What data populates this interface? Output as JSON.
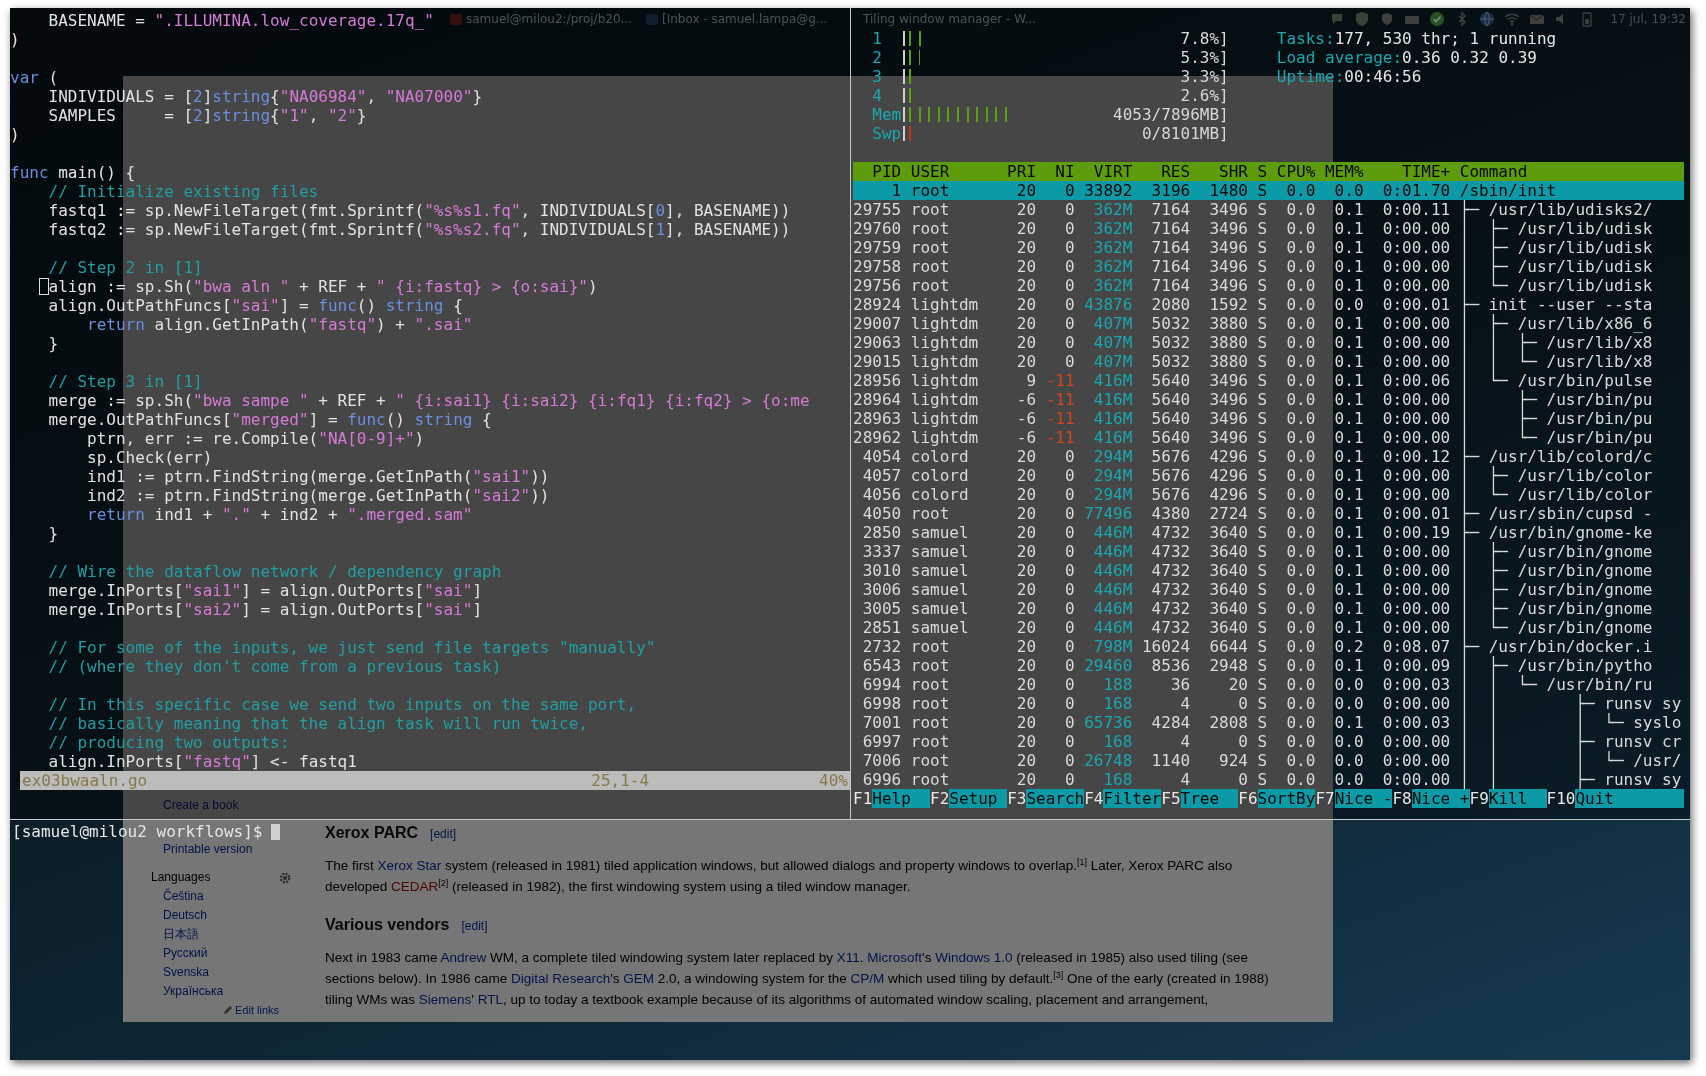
{
  "taskbar": {
    "windows": [
      {
        "title": "samuel@milou2:/proj/b20..."
      },
      {
        "title": "[Inbox - samuel.lampa@g..."
      }
    ],
    "active_title": "Tiling window manager - W...",
    "clock": "17 jul, 19:32"
  },
  "editor": {
    "lines": [
      {
        "kind": "code",
        "segs": [
          {
            "kind": "plain",
            "text": "    BASENAME = "
          },
          {
            "kind": "string",
            "text": "\".ILLUMINA.low_coverage.17q_\""
          }
        ]
      },
      {
        "kind": "code",
        "segs": [
          {
            "kind": "plain",
            "text": ")"
          }
        ]
      },
      {
        "kind": "blank"
      },
      {
        "kind": "code",
        "segs": [
          {
            "kind": "keyword",
            "text": "var"
          },
          {
            "kind": "plain",
            "text": " ("
          }
        ]
      },
      {
        "kind": "code",
        "segs": [
          {
            "kind": "plain",
            "text": "    INDIVIDUALS = ["
          },
          {
            "kind": "number",
            "text": "2"
          },
          {
            "kind": "plain",
            "text": "]"
          },
          {
            "kind": "keyword",
            "text": "string"
          },
          {
            "kind": "plain",
            "text": "{"
          },
          {
            "kind": "string",
            "text": "\"NA06984\""
          },
          {
            "kind": "plain",
            "text": ", "
          },
          {
            "kind": "string",
            "text": "\"NA07000\""
          },
          {
            "kind": "plain",
            "text": "}"
          }
        ]
      },
      {
        "kind": "code",
        "segs": [
          {
            "kind": "plain",
            "text": "    SAMPLES     = ["
          },
          {
            "kind": "number",
            "text": "2"
          },
          {
            "kind": "plain",
            "text": "]"
          },
          {
            "kind": "keyword",
            "text": "string"
          },
          {
            "kind": "plain",
            "text": "{"
          },
          {
            "kind": "string",
            "text": "\"1\""
          },
          {
            "kind": "plain",
            "text": ", "
          },
          {
            "kind": "string",
            "text": "\"2\""
          },
          {
            "kind": "plain",
            "text": "}"
          }
        ]
      },
      {
        "kind": "code",
        "segs": [
          {
            "kind": "plain",
            "text": ")"
          }
        ]
      },
      {
        "kind": "blank"
      },
      {
        "kind": "code",
        "segs": [
          {
            "kind": "keyword",
            "text": "func"
          },
          {
            "kind": "plain",
            "text": " main() {"
          }
        ]
      },
      {
        "kind": "code",
        "segs": [
          {
            "kind": "comment",
            "text": "    // Initialize existing files"
          }
        ]
      },
      {
        "kind": "code",
        "segs": [
          {
            "kind": "plain",
            "text": "    fastq1 := sp.NewFileTarget(fmt.Sprintf("
          },
          {
            "kind": "string",
            "text": "\"%s%s1.fq\""
          },
          {
            "kind": "plain",
            "text": ", INDIVIDUALS["
          },
          {
            "kind": "number",
            "text": "0"
          },
          {
            "kind": "plain",
            "text": "], BASENAME))"
          }
        ]
      },
      {
        "kind": "code",
        "segs": [
          {
            "kind": "plain",
            "text": "    fastq2 := sp.NewFileTarget(fmt.Sprintf("
          },
          {
            "kind": "string",
            "text": "\"%s%s2.fq\""
          },
          {
            "kind": "plain",
            "text": ", INDIVIDUALS["
          },
          {
            "kind": "number",
            "text": "1"
          },
          {
            "kind": "plain",
            "text": "], BASENAME))"
          }
        ]
      },
      {
        "kind": "blank"
      },
      {
        "kind": "code",
        "segs": [
          {
            "kind": "comment",
            "text": "    // Step 2 in [1]"
          }
        ]
      },
      {
        "kind": "code",
        "cursor": true,
        "segs": [
          {
            "kind": "plain",
            "text": "    align := sp.Sh("
          },
          {
            "kind": "string",
            "text": "\"bwa aln \""
          },
          {
            "kind": "plain",
            "text": " + REF + "
          },
          {
            "kind": "string",
            "text": "\" {i:fastq} > {o:sai}\""
          },
          {
            "kind": "plain",
            "text": ")"
          }
        ]
      },
      {
        "kind": "code",
        "segs": [
          {
            "kind": "plain",
            "text": "    align.OutPathFuncs["
          },
          {
            "kind": "string",
            "text": "\"sai\""
          },
          {
            "kind": "plain",
            "text": "] = "
          },
          {
            "kind": "keyword",
            "text": "func"
          },
          {
            "kind": "plain",
            "text": "() "
          },
          {
            "kind": "keyword",
            "text": "string"
          },
          {
            "kind": "plain",
            "text": " {"
          }
        ]
      },
      {
        "kind": "code",
        "segs": [
          {
            "kind": "keyword",
            "text": "        return"
          },
          {
            "kind": "plain",
            "text": " align.GetInPath("
          },
          {
            "kind": "string",
            "text": "\"fastq\""
          },
          {
            "kind": "plain",
            "text": ") + "
          },
          {
            "kind": "string",
            "text": "\".sai\""
          }
        ]
      },
      {
        "kind": "code",
        "segs": [
          {
            "kind": "plain",
            "text": "    }"
          }
        ]
      },
      {
        "kind": "blank"
      },
      {
        "kind": "code",
        "segs": [
          {
            "kind": "comment",
            "text": "    // Step 3 in [1]"
          }
        ]
      },
      {
        "kind": "code",
        "segs": [
          {
            "kind": "plain",
            "text": "    merge := sp.Sh("
          },
          {
            "kind": "string",
            "text": "\"bwa sampe \""
          },
          {
            "kind": "plain",
            "text": " + REF + "
          },
          {
            "kind": "string",
            "text": "\" {i:sai1} {i:sai2} {i:fq1} {i:fq2} > {o:me"
          }
        ]
      },
      {
        "kind": "code",
        "segs": [
          {
            "kind": "plain",
            "text": "    merge.OutPathFuncs["
          },
          {
            "kind": "string",
            "text": "\"merged\""
          },
          {
            "kind": "plain",
            "text": "] = "
          },
          {
            "kind": "keyword",
            "text": "func"
          },
          {
            "kind": "plain",
            "text": "() "
          },
          {
            "kind": "keyword",
            "text": "string"
          },
          {
            "kind": "plain",
            "text": " {"
          }
        ]
      },
      {
        "kind": "code",
        "segs": [
          {
            "kind": "plain",
            "text": "        ptrn, err := re.Compile("
          },
          {
            "kind": "string",
            "text": "\"NA[0-9]+\""
          },
          {
            "kind": "plain",
            "text": ")"
          }
        ]
      },
      {
        "kind": "code",
        "segs": [
          {
            "kind": "plain",
            "text": "        sp.Check(err)"
          }
        ]
      },
      {
        "kind": "code",
        "segs": [
          {
            "kind": "plain",
            "text": "        ind1 := ptrn.FindString(merge.GetInPath("
          },
          {
            "kind": "string",
            "text": "\"sai1\""
          },
          {
            "kind": "plain",
            "text": "))"
          }
        ]
      },
      {
        "kind": "code",
        "segs": [
          {
            "kind": "plain",
            "text": "        ind2 := ptrn.FindString(merge.GetInPath("
          },
          {
            "kind": "string",
            "text": "\"sai2\""
          },
          {
            "kind": "plain",
            "text": "))"
          }
        ]
      },
      {
        "kind": "code",
        "segs": [
          {
            "kind": "keyword",
            "text": "        return"
          },
          {
            "kind": "plain",
            "text": " ind1 + "
          },
          {
            "kind": "string",
            "text": "\".\""
          },
          {
            "kind": "plain",
            "text": " + ind2 + "
          },
          {
            "kind": "string",
            "text": "\".merged.sam\""
          }
        ]
      },
      {
        "kind": "code",
        "segs": [
          {
            "kind": "plain",
            "text": "    }"
          }
        ]
      },
      {
        "kind": "blank"
      },
      {
        "kind": "code",
        "segs": [
          {
            "kind": "comment",
            "text": "    // Wire the dataflow network / dependency graph"
          }
        ]
      },
      {
        "kind": "code",
        "segs": [
          {
            "kind": "plain",
            "text": "    merge.InPorts["
          },
          {
            "kind": "string",
            "text": "\"sai1\""
          },
          {
            "kind": "plain",
            "text": "] = align.OutPorts["
          },
          {
            "kind": "string",
            "text": "\"sai\""
          },
          {
            "kind": "plain",
            "text": "]"
          }
        ]
      },
      {
        "kind": "code",
        "segs": [
          {
            "kind": "plain",
            "text": "    merge.InPorts["
          },
          {
            "kind": "string",
            "text": "\"sai2\""
          },
          {
            "kind": "plain",
            "text": "] = align.OutPorts["
          },
          {
            "kind": "string",
            "text": "\"sai\""
          },
          {
            "kind": "plain",
            "text": "]"
          }
        ]
      },
      {
        "kind": "blank"
      },
      {
        "kind": "code",
        "segs": [
          {
            "kind": "comment",
            "text": "    // For some of the inputs, we just send file targets \"manually\""
          }
        ]
      },
      {
        "kind": "code",
        "segs": [
          {
            "kind": "comment",
            "text": "    // (where they don't come from a previous task)"
          }
        ]
      },
      {
        "kind": "blank"
      },
      {
        "kind": "code",
        "segs": [
          {
            "kind": "comment",
            "text": "    // In this specific case we send two inputs on the same port,"
          }
        ]
      },
      {
        "kind": "code",
        "segs": [
          {
            "kind": "comment",
            "text": "    // basically meaning that the align task will run twice,"
          }
        ]
      },
      {
        "kind": "code",
        "segs": [
          {
            "kind": "comment",
            "text": "    // producing two outputs:"
          }
        ]
      },
      {
        "kind": "code",
        "segs": [
          {
            "kind": "plain",
            "text": "    align.InPorts["
          },
          {
            "kind": "string",
            "text": "\"fastq\""
          },
          {
            "kind": "plain",
            "text": "] <- fastq1"
          }
        ]
      }
    ],
    "status": {
      "file": "ex03bwaaln.go",
      "position": "25,1-4",
      "scroll": "40%"
    }
  },
  "htop": {
    "meters": [
      {
        "label": "1",
        "level": 0.078,
        "reading": "7.8%]"
      },
      {
        "label": "2",
        "level": 0.053,
        "reading": "5.3%]"
      },
      {
        "label": "3",
        "level": 0.033,
        "reading": "3.3%]"
      },
      {
        "label": "4",
        "level": 0.026,
        "reading": "2.6%]"
      },
      {
        "label": "Mem",
        "level": 0.51,
        "reading": "4053/7896MB]"
      },
      {
        "label": "Swp",
        "level": 0.01,
        "reading": "0/8101MB]"
      }
    ],
    "stats": [
      {
        "label": "Tasks:",
        "value": "177, 530 thr; 1 running"
      },
      {
        "label": "Load average:",
        "value": "0.36 0.32 0.39"
      },
      {
        "label": "Uptime:",
        "value": "00:46:56"
      }
    ],
    "columns": [
      "PID",
      "USER",
      "PRI",
      "NI",
      "VIRT",
      "RES",
      "SHR",
      "S",
      "CPU%",
      "MEM%",
      "TIME+",
      "Command"
    ],
    "processes": [
      {
        "pid": "1",
        "user": "root",
        "pri": "20",
        "ni": "0",
        "virt": "33892",
        "res": "3196",
        "shr": "1480",
        "s": "S",
        "cpu": "0.0",
        "mem": "0.0",
        "time": "0:01.70",
        "command": "/sbin/init",
        "selected": true
      },
      {
        "pid": "29755",
        "user": "root",
        "pri": "20",
        "ni": "0",
        "virt": "362M",
        "res": "7164",
        "shr": "3496",
        "s": "S",
        "cpu": "0.0",
        "mem": "0.1",
        "time": "0:00.11",
        "command": "├─ /usr/lib/udisks2/",
        "selected": false
      },
      {
        "pid": "29760",
        "user": "root",
        "pri": "20",
        "ni": "0",
        "virt": "362M",
        "res": "7164",
        "shr": "3496",
        "s": "S",
        "cpu": "0.0",
        "mem": "0.1",
        "time": "0:00.00",
        "command": "│  ├─ /usr/lib/udisk",
        "selected": false
      },
      {
        "pid": "29759",
        "user": "root",
        "pri": "20",
        "ni": "0",
        "virt": "362M",
        "res": "7164",
        "shr": "3496",
        "s": "S",
        "cpu": "0.0",
        "mem": "0.1",
        "time": "0:00.00",
        "command": "│  ├─ /usr/lib/udisk",
        "selected": false
      },
      {
        "pid": "29758",
        "user": "root",
        "pri": "20",
        "ni": "0",
        "virt": "362M",
        "res": "7164",
        "shr": "3496",
        "s": "S",
        "cpu": "0.0",
        "mem": "0.1",
        "time": "0:00.00",
        "command": "│  ├─ /usr/lib/udisk",
        "selected": false
      },
      {
        "pid": "29756",
        "user": "root",
        "pri": "20",
        "ni": "0",
        "virt": "362M",
        "res": "7164",
        "shr": "3496",
        "s": "S",
        "cpu": "0.0",
        "mem": "0.1",
        "time": "0:00.00",
        "command": "│  └─ /usr/lib/udisk",
        "selected": false
      },
      {
        "pid": "28924",
        "user": "lightdm",
        "pri": "20",
        "ni": "0",
        "virt": "43876",
        "res": "2080",
        "shr": "1592",
        "s": "S",
        "cpu": "0.0",
        "mem": "0.0",
        "time": "0:00.01",
        "command": "├─ init --user --sta",
        "selected": false
      },
      {
        "pid": "29007",
        "user": "lightdm",
        "pri": "20",
        "ni": "0",
        "virt": "407M",
        "res": "5032",
        "shr": "3880",
        "s": "S",
        "cpu": "0.0",
        "mem": "0.1",
        "time": "0:00.00",
        "command": "│  ├─ /usr/lib/x86_6",
        "selected": false
      },
      {
        "pid": "29063",
        "user": "lightdm",
        "pri": "20",
        "ni": "0",
        "virt": "407M",
        "res": "5032",
        "shr": "3880",
        "s": "S",
        "cpu": "0.0",
        "mem": "0.1",
        "time": "0:00.00",
        "command": "│  │  ├─ /usr/lib/x8",
        "selected": false
      },
      {
        "pid": "29015",
        "user": "lightdm",
        "pri": "20",
        "ni": "0",
        "virt": "407M",
        "res": "5032",
        "shr": "3880",
        "s": "S",
        "cpu": "0.0",
        "mem": "0.1",
        "time": "0:00.00",
        "command": "│  │  └─ /usr/lib/x8",
        "selected": false
      },
      {
        "pid": "28956",
        "user": "lightdm",
        "pri": "9",
        "ni": "-11",
        "virt": "416M",
        "res": "5640",
        "shr": "3496",
        "s": "S",
        "cpu": "0.0",
        "mem": "0.1",
        "time": "0:00.06",
        "command": "│  └─ /usr/bin/pulse",
        "selected": false
      },
      {
        "pid": "28964",
        "user": "lightdm",
        "pri": "-6",
        "ni": "-11",
        "virt": "416M",
        "res": "5640",
        "shr": "3496",
        "s": "S",
        "cpu": "0.0",
        "mem": "0.1",
        "time": "0:00.00",
        "command": "│     ├─ /usr/bin/pu",
        "selected": false
      },
      {
        "pid": "28963",
        "user": "lightdm",
        "pri": "-6",
        "ni": "-11",
        "virt": "416M",
        "res": "5640",
        "shr": "3496",
        "s": "S",
        "cpu": "0.0",
        "mem": "0.1",
        "time": "0:00.00",
        "command": "│     ├─ /usr/bin/pu",
        "selected": false
      },
      {
        "pid": "28962",
        "user": "lightdm",
        "pri": "-6",
        "ni": "-11",
        "virt": "416M",
        "res": "5640",
        "shr": "3496",
        "s": "S",
        "cpu": "0.0",
        "mem": "0.1",
        "time": "0:00.00",
        "command": "│     └─ /usr/bin/pu",
        "selected": false
      },
      {
        "pid": "4054",
        "user": "colord",
        "pri": "20",
        "ni": "0",
        "virt": "294M",
        "res": "5676",
        "shr": "4296",
        "s": "S",
        "cpu": "0.0",
        "mem": "0.1",
        "time": "0:00.12",
        "command": "├─ /usr/lib/colord/c",
        "selected": false
      },
      {
        "pid": "4057",
        "user": "colord",
        "pri": "20",
        "ni": "0",
        "virt": "294M",
        "res": "5676",
        "shr": "4296",
        "s": "S",
        "cpu": "0.0",
        "mem": "0.1",
        "time": "0:00.00",
        "command": "│  ├─ /usr/lib/color",
        "selected": false
      },
      {
        "pid": "4056",
        "user": "colord",
        "pri": "20",
        "ni": "0",
        "virt": "294M",
        "res": "5676",
        "shr": "4296",
        "s": "S",
        "cpu": "0.0",
        "mem": "0.1",
        "time": "0:00.00",
        "command": "│  └─ /usr/lib/color",
        "selected": false
      },
      {
        "pid": "4050",
        "user": "root",
        "pri": "20",
        "ni": "0",
        "virt": "77496",
        "res": "4380",
        "shr": "2724",
        "s": "S",
        "cpu": "0.0",
        "mem": "0.1",
        "time": "0:00.01",
        "command": "├─ /usr/sbin/cupsd -",
        "selected": false
      },
      {
        "pid": "2850",
        "user": "samuel",
        "pri": "20",
        "ni": "0",
        "virt": "446M",
        "res": "4732",
        "shr": "3640",
        "s": "S",
        "cpu": "0.0",
        "mem": "0.1",
        "time": "0:00.19",
        "command": "├─ /usr/bin/gnome-ke",
        "selected": false
      },
      {
        "pid": "3337",
        "user": "samuel",
        "pri": "20",
        "ni": "0",
        "virt": "446M",
        "res": "4732",
        "shr": "3640",
        "s": "S",
        "cpu": "0.0",
        "mem": "0.1",
        "time": "0:00.00",
        "command": "│  ├─ /usr/bin/gnome",
        "selected": false
      },
      {
        "pid": "3010",
        "user": "samuel",
        "pri": "20",
        "ni": "0",
        "virt": "446M",
        "res": "4732",
        "shr": "3640",
        "s": "S",
        "cpu": "0.0",
        "mem": "0.1",
        "time": "0:00.00",
        "command": "│  ├─ /usr/bin/gnome",
        "selected": false
      },
      {
        "pid": "3006",
        "user": "samuel",
        "pri": "20",
        "ni": "0",
        "virt": "446M",
        "res": "4732",
        "shr": "3640",
        "s": "S",
        "cpu": "0.0",
        "mem": "0.1",
        "time": "0:00.00",
        "command": "│  ├─ /usr/bin/gnome",
        "selected": false
      },
      {
        "pid": "3005",
        "user": "samuel",
        "pri": "20",
        "ni": "0",
        "virt": "446M",
        "res": "4732",
        "shr": "3640",
        "s": "S",
        "cpu": "0.0",
        "mem": "0.1",
        "time": "0:00.00",
        "command": "│  ├─ /usr/bin/gnome",
        "selected": false
      },
      {
        "pid": "2851",
        "user": "samuel",
        "pri": "20",
        "ni": "0",
        "virt": "446M",
        "res": "4732",
        "shr": "3640",
        "s": "S",
        "cpu": "0.0",
        "mem": "0.1",
        "time": "0:00.00",
        "command": "│  └─ /usr/bin/gnome",
        "selected": false
      },
      {
        "pid": "2732",
        "user": "root",
        "pri": "20",
        "ni": "0",
        "virt": "798M",
        "res": "16024",
        "shr": "6644",
        "s": "S",
        "cpu": "0.0",
        "mem": "0.2",
        "time": "0:08.07",
        "command": "├─ /usr/bin/docker.i",
        "selected": false
      },
      {
        "pid": "6543",
        "user": "root",
        "pri": "20",
        "ni": "0",
        "virt": "29460",
        "res": "8536",
        "shr": "2948",
        "s": "S",
        "cpu": "0.0",
        "mem": "0.1",
        "time": "0:00.09",
        "command": "│  ├─ /usr/bin/pytho",
        "selected": false
      },
      {
        "pid": "6994",
        "user": "root",
        "pri": "20",
        "ni": "0",
        "virt": "188",
        "res": "36",
        "shr": "20",
        "s": "S",
        "cpu": "0.0",
        "mem": "0.0",
        "time": "0:00.03",
        "command": "│  │  └─ /usr/bin/ru",
        "selected": false
      },
      {
        "pid": "6998",
        "user": "root",
        "pri": "20",
        "ni": "0",
        "virt": "168",
        "res": "4",
        "shr": "0",
        "s": "S",
        "cpu": "0.0",
        "mem": "0.0",
        "time": "0:00.00",
        "command": "│  │        ├─ runsv sy",
        "selected": false
      },
      {
        "pid": "7001",
        "user": "root",
        "pri": "20",
        "ni": "0",
        "virt": "65736",
        "res": "4284",
        "shr": "2808",
        "s": "S",
        "cpu": "0.0",
        "mem": "0.1",
        "time": "0:00.03",
        "command": "│  │        │  └─ syslo",
        "selected": false
      },
      {
        "pid": "6997",
        "user": "root",
        "pri": "20",
        "ni": "0",
        "virt": "168",
        "res": "4",
        "shr": "0",
        "s": "S",
        "cpu": "0.0",
        "mem": "0.0",
        "time": "0:00.00",
        "command": "│  │        ├─ runsv cr",
        "selected": false
      },
      {
        "pid": "7006",
        "user": "root",
        "pri": "20",
        "ni": "0",
        "virt": "26748",
        "res": "1140",
        "shr": "924",
        "s": "S",
        "cpu": "0.0",
        "mem": "0.0",
        "time": "0:00.00",
        "command": "│  │        │  └─ /usr/",
        "selected": false
      },
      {
        "pid": "6996",
        "user": "root",
        "pri": "20",
        "ni": "0",
        "virt": "168",
        "res": "4",
        "shr": "0",
        "s": "S",
        "cpu": "0.0",
        "mem": "0.0",
        "time": "0:00.00",
        "command": "│  │        ├─ runsv sy",
        "selected": false
      }
    ],
    "function_keys": [
      {
        "key": "F1",
        "label": "Help"
      },
      {
        "key": "F2",
        "label": "Setup"
      },
      {
        "key": "F3",
        "label": "Search"
      },
      {
        "key": "F4",
        "label": "Filter"
      },
      {
        "key": "F5",
        "label": "Tree"
      },
      {
        "key": "F6",
        "label": "SortBy"
      },
      {
        "key": "F7",
        "label": "Nice -"
      },
      {
        "key": "F8",
        "label": "Nice +"
      },
      {
        "key": "F9",
        "label": "Kill"
      },
      {
        "key": "F10",
        "label": "Quit"
      }
    ]
  },
  "shell": {
    "prompt": "[samuel@milou2 workflows]$"
  },
  "browser": {
    "sidebar": {
      "links": [
        "Create a book",
        "Printable version"
      ],
      "languages_heading": "Languages",
      "languages": [
        "Čeština",
        "Deutsch",
        "日本語",
        "Русский",
        "Svenska",
        "Українська"
      ],
      "edit_links": "Edit links"
    },
    "article": [
      {
        "kind": "heading",
        "text": "Xerox PARC",
        "edit": "[edit]"
      },
      {
        "kind": "paragraph",
        "segs": [
          {
            "kind": "text",
            "text": "The first "
          },
          {
            "kind": "link",
            "text": "Xerox Star"
          },
          {
            "kind": "text",
            "text": " system (released in 1981) tiled application windows, but allowed dialogs and property windows to overlap."
          },
          {
            "kind": "sup",
            "text": "[1]"
          },
          {
            "kind": "text",
            "text": " Later, Xerox PARC also developed "
          },
          {
            "kind": "new_link",
            "text": "CEDAR"
          },
          {
            "kind": "sup",
            "text": "[2]"
          },
          {
            "kind": "text",
            "text": " (released in 1982), the first windowing system using a tiled window manager."
          }
        ]
      },
      {
        "kind": "heading",
        "text": "Various vendors",
        "edit": "[edit]"
      },
      {
        "kind": "paragraph",
        "segs": [
          {
            "kind": "text",
            "text": "Next in 1983 came "
          },
          {
            "kind": "link",
            "text": "Andrew"
          },
          {
            "kind": "text",
            "text": " WM, a complete tiled windowing system later replaced by "
          },
          {
            "kind": "link",
            "text": "X11"
          },
          {
            "kind": "text",
            "text": ". "
          },
          {
            "kind": "link",
            "text": "Microsoft"
          },
          {
            "kind": "text",
            "text": "'s "
          },
          {
            "kind": "link",
            "text": "Windows 1.0"
          },
          {
            "kind": "text",
            "text": " (released in 1985) also used tiling (see sections below). In 1986 came "
          },
          {
            "kind": "link",
            "text": "Digital Research"
          },
          {
            "kind": "text",
            "text": "'s "
          },
          {
            "kind": "link",
            "text": "GEM"
          },
          {
            "kind": "text",
            "text": " 2.0, a windowing system for the "
          },
          {
            "kind": "link",
            "text": "CP/M"
          },
          {
            "kind": "text",
            "text": " which used tiling by default."
          },
          {
            "kind": "sup",
            "text": "[3]"
          },
          {
            "kind": "text",
            "text": " One of the early (created in 1988) tiling WMs was "
          },
          {
            "kind": "link",
            "text": "Siemens"
          },
          {
            "kind": "text",
            "text": "' "
          },
          {
            "kind": "link",
            "text": "RTL"
          },
          {
            "kind": "text",
            "text": ", up to today a textbook example because of its algorithms of automated window scaling, placement and arrangement,"
          }
        ]
      }
    ]
  }
}
